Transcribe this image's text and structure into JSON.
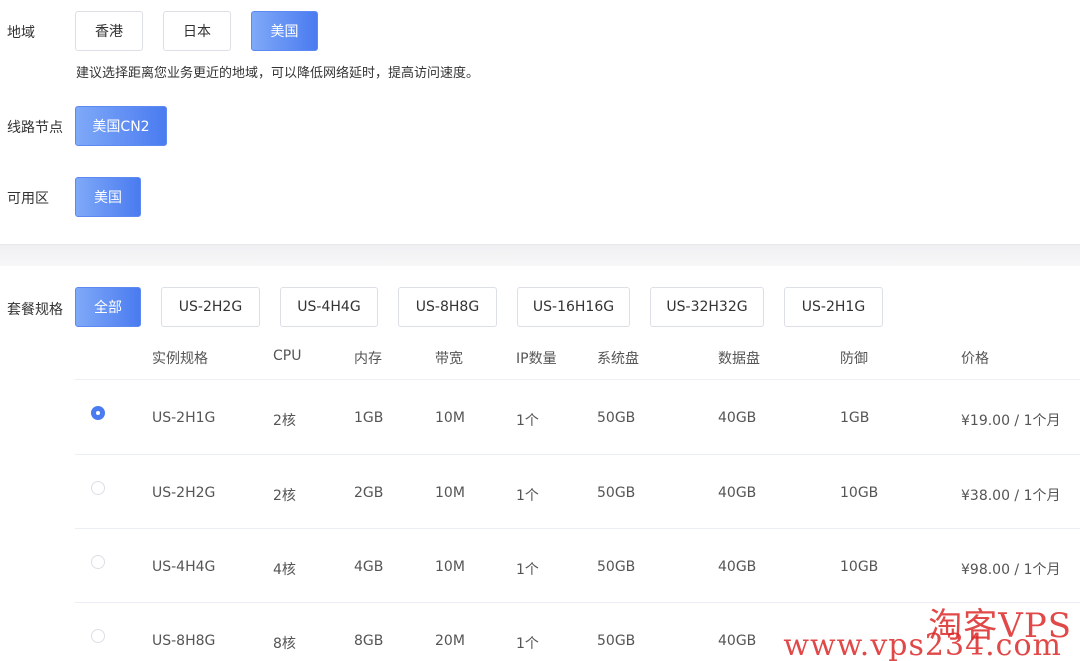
{
  "region": {
    "label": "地域",
    "options": [
      "香港",
      "日本",
      "美国"
    ],
    "selected": "美国",
    "hint": "建议选择距离您业务更近的地域，可以降低网络延时，提高访问速度。"
  },
  "line_node": {
    "label": "线路节点",
    "options": [
      "美国CN2"
    ],
    "selected": "美国CN2"
  },
  "zone": {
    "label": "可用区",
    "options": [
      "美国"
    ],
    "selected": "美国"
  },
  "plan": {
    "label": "套餐规格",
    "filters": [
      "全部",
      "US-2H2G",
      "US-4H4G",
      "US-8H8G",
      "US-16H16G",
      "US-32H32G",
      "US-2H1G"
    ],
    "selected_filter": "全部",
    "columns": [
      "实例规格",
      "CPU",
      "内存",
      "带宽",
      "IP数量",
      "系统盘",
      "数据盘",
      "防御",
      "价格"
    ],
    "rows": [
      {
        "spec": "US-2H1G",
        "cpu": "2核",
        "mem": "1GB",
        "bw": "10M",
        "ip": "1个",
        "sys": "50GB",
        "data": "40GB",
        "ddos": "1GB",
        "price": "¥19.00 / 1个月",
        "checked": true
      },
      {
        "spec": "US-2H2G",
        "cpu": "2核",
        "mem": "2GB",
        "bw": "10M",
        "ip": "1个",
        "sys": "50GB",
        "data": "40GB",
        "ddos": "10GB",
        "price": "¥38.00 / 1个月",
        "checked": false
      },
      {
        "spec": "US-4H4G",
        "cpu": "4核",
        "mem": "4GB",
        "bw": "10M",
        "ip": "1个",
        "sys": "50GB",
        "data": "40GB",
        "ddos": "10GB",
        "price": "¥98.00 / 1个月",
        "checked": false
      },
      {
        "spec": "US-8H8G",
        "cpu": "8核",
        "mem": "8GB",
        "bw": "20M",
        "ip": "1个",
        "sys": "50GB",
        "data": "40GB",
        "ddos": "",
        "price": "",
        "checked": false
      }
    ]
  },
  "watermark": {
    "line1": "淘客VPS",
    "line2": "www.vps234.com"
  },
  "colors": {
    "accent_start": "#7fa9f8",
    "accent_end": "#4a7bf0",
    "watermark": "#dc2828"
  }
}
